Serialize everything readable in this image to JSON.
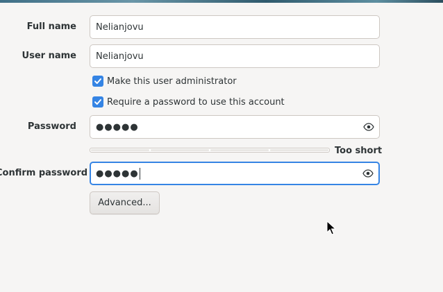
{
  "form": {
    "full_name": {
      "label": "Full name",
      "value": "Nelianjovu"
    },
    "user_name": {
      "label": "User name",
      "value": "Nelianjovu"
    },
    "admin_checkbox": {
      "label": "Make this user administrator",
      "checked": true
    },
    "require_password_checkbox": {
      "label": "Require a password to use this account",
      "checked": true
    },
    "password": {
      "label": "Password",
      "masked_value": "●●●●●",
      "reveal_icon": "eye-icon"
    },
    "strength": {
      "label": "Too short",
      "level": 0
    },
    "confirm_password": {
      "label": "Confirm password",
      "masked_value": "●●●●●",
      "reveal_icon": "eye-icon"
    },
    "advanced_button": {
      "label": "Advanced..."
    }
  },
  "colors": {
    "accent": "#3584e4",
    "background": "#f6f5f4",
    "text": "#2e3436"
  }
}
